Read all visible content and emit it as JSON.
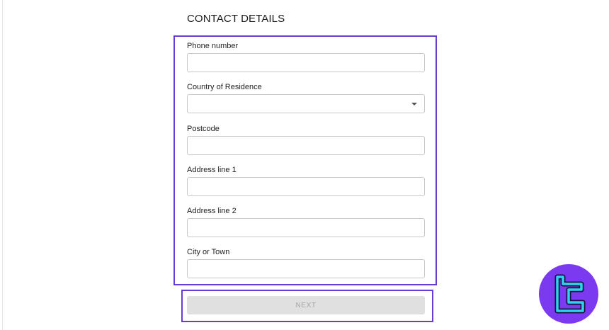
{
  "form": {
    "title": "CONTACT DETAILS",
    "fields": [
      {
        "label": "Phone number",
        "type": "text",
        "value": ""
      },
      {
        "label": "Country of Residence",
        "type": "select",
        "value": ""
      },
      {
        "label": "Postcode",
        "type": "text",
        "value": ""
      },
      {
        "label": "Address line 1",
        "type": "text",
        "value": ""
      },
      {
        "label": "Address line 2",
        "type": "text",
        "value": ""
      },
      {
        "label": "City or Town",
        "type": "text",
        "value": ""
      }
    ],
    "next_label": "NEXT"
  },
  "colors": {
    "highlight": "#6a3dd2",
    "button_disabled": "#e0e0e0",
    "logo_bg": "#7b39f0",
    "logo_mark": "#2fd3f0"
  },
  "icons": {
    "dropdown": "caret-down-icon",
    "logo": "brand-logo-icon"
  }
}
